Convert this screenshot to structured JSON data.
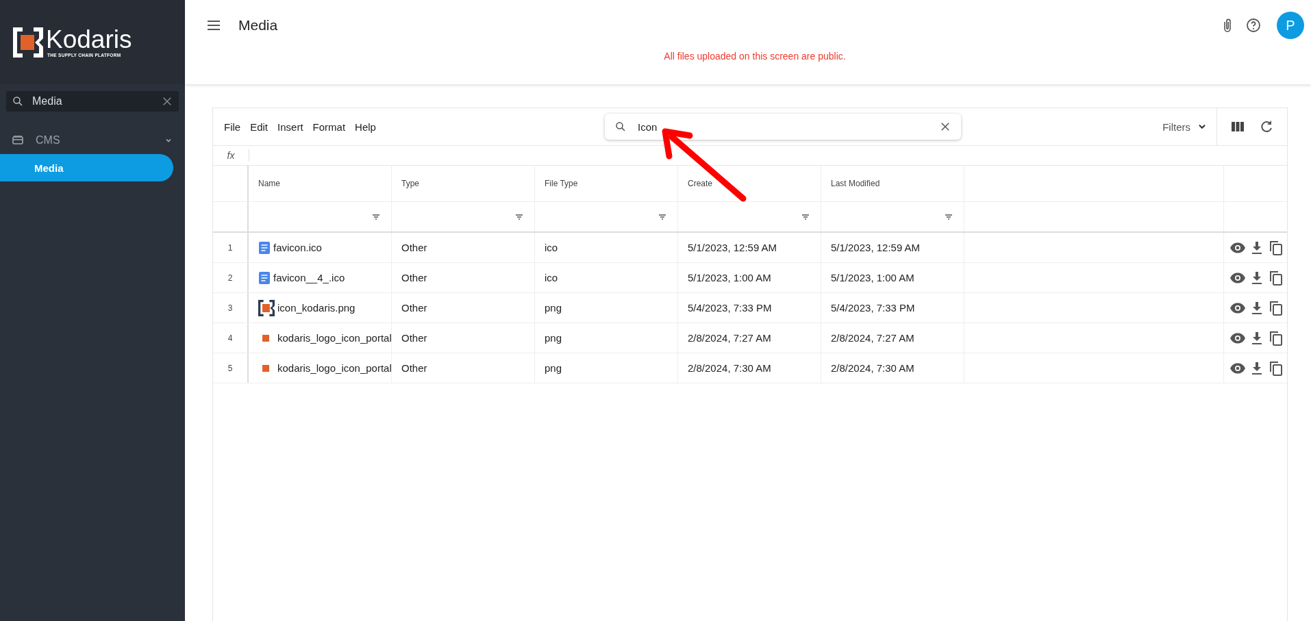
{
  "logo": {
    "name": "Kodaris",
    "tagline": "THE SUPPLY CHAIN PLATFORM"
  },
  "sidebar": {
    "search": {
      "value": "Media"
    },
    "items": [
      {
        "label": "CMS",
        "expanded": true,
        "selected": false,
        "children": [
          {
            "label": "Media",
            "selected": true
          }
        ]
      }
    ]
  },
  "header": {
    "title": "Media",
    "avatar": "P",
    "notice": "All files uploaded on this screen are public."
  },
  "toolbar": {
    "menus": [
      "File",
      "Edit",
      "Insert",
      "Format",
      "Help"
    ],
    "search": {
      "value": "Icon"
    },
    "filters": "Filters"
  },
  "formula_bar": {
    "label": "fx"
  },
  "table": {
    "columns": [
      "Name",
      "Type",
      "File Type",
      "Create",
      "Last Modified"
    ],
    "rows": [
      {
        "index": "1",
        "kind": "document",
        "name": "favicon.ico",
        "type": "Other",
        "file_type": "ico",
        "created": "5/1/2023, 12:59 AM",
        "modified": "5/1/2023, 12:59 AM"
      },
      {
        "index": "2",
        "kind": "document",
        "name": "favicon__4_.ico",
        "type": "Other",
        "file_type": "ico",
        "created": "5/1/2023, 1:00 AM",
        "modified": "5/1/2023, 1:00 AM"
      },
      {
        "index": "3",
        "kind": "logo",
        "name": "icon_kodaris.png",
        "type": "Other",
        "file_type": "png",
        "created": "5/4/2023, 7:33 PM",
        "modified": "5/4/2023, 7:33 PM"
      },
      {
        "index": "4",
        "kind": "square",
        "name": "kodaris_logo_icon_portal",
        "type": "Other",
        "file_type": "png",
        "created": "2/8/2024, 7:27 AM",
        "modified": "2/8/2024, 7:27 AM"
      },
      {
        "index": "5",
        "kind": "square",
        "name": "kodaris_logo_icon_portal",
        "type": "Other",
        "file_type": "png",
        "created": "2/8/2024, 7:30 AM",
        "modified": "2/8/2024, 7:30 AM"
      }
    ]
  },
  "annotation": {
    "kind": "arrow"
  }
}
